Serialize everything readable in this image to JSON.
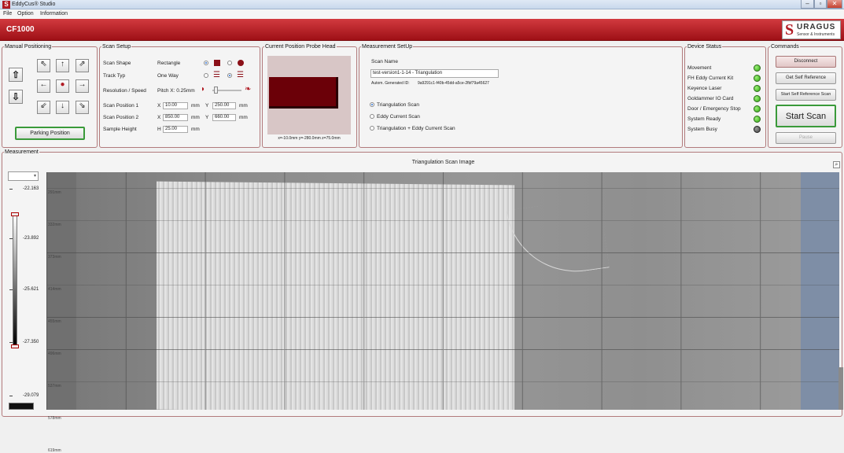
{
  "window": {
    "title": "EddyCus® Studio",
    "app_icon": "S",
    "controls": [
      "minimize-icon",
      "restore-icon",
      "close-icon"
    ]
  },
  "menu": [
    "File",
    "Option",
    "Information"
  ],
  "header": {
    "title": "CF1000",
    "logo_mark": "S",
    "logo_main": "URAGUS",
    "logo_sub": "Sensor & Instruments",
    "bg": "#b01b23"
  },
  "manual": {
    "legend": "Manual Positioning",
    "parking": "Parking Position"
  },
  "scan_setup": {
    "legend": "Scan Setup",
    "labels": {
      "shape": "Scan Shape",
      "track": "Track Typ",
      "resolution": "Resolution / Speed",
      "pos1": "Scan Position 1",
      "pos2": "Scan Position 2",
      "height": "Sample Height"
    },
    "shape_value": "Rectangle",
    "track_value": "One Way",
    "pitch": "Pitch X: 0.25mm",
    "pos1": {
      "x_label": "X",
      "x": "10.00",
      "x_unit": "mm",
      "y_label": "Y",
      "y": "250.00",
      "y_unit": "mm"
    },
    "pos2": {
      "x_label": "X",
      "x": "850.00",
      "x_unit": "mm",
      "y_label": "Y",
      "y": "660.00",
      "y_unit": "mm"
    },
    "height": {
      "label": "H",
      "value": "25.00",
      "unit": "mm"
    }
  },
  "probe": {
    "legend": "Current Position Probe Head",
    "coords": "x=-10.0mm y=-280.0mm z=75.0mm"
  },
  "measurement_setup": {
    "legend": "Measurement SetUp",
    "scan_name_label": "Scan Name",
    "scan_name": "test-version1-1-14 - Triangulation",
    "autom_label": "Autom. Generated ID:",
    "autom_id": "9a9291c1-f40b-45dd-a5ce-2fbf79a45627",
    "options": [
      "Triangulation Scan",
      "Eddy Current Scan",
      "Triangulation + Eddy Current Scan"
    ],
    "selected": 0
  },
  "device_status": {
    "legend": "Device Status",
    "items": [
      {
        "label": "Movement",
        "state": "on"
      },
      {
        "label": "FH Eddy Current Kit",
        "state": "on"
      },
      {
        "label": "Keyence Laser",
        "state": "on"
      },
      {
        "label": "Goldammer IO Card",
        "state": "on"
      },
      {
        "label": "Door / Emergency Stop",
        "state": "on"
      },
      {
        "label": "System Ready",
        "state": "on"
      },
      {
        "label": "System Busy",
        "state": "off"
      }
    ]
  },
  "commands": {
    "legend": "Commands",
    "disconnect": "Disconnect",
    "self_ref": "Get Self Reference",
    "start_self_ref": "Start Self Reference Scan",
    "start_scan": "Start Scan",
    "pause": "Pause"
  },
  "measurement": {
    "legend": "Measurement",
    "image_title": "Triangulation Scan Image",
    "scale": [
      "-22.163",
      "-23.892",
      "-25.621",
      "-27.350",
      "-29.079"
    ],
    "y_ticks": [
      "291mm",
      "332mm",
      "373mm",
      "414mm",
      "455mm",
      "496mm",
      "537mm",
      "578mm",
      "619mm"
    ]
  }
}
